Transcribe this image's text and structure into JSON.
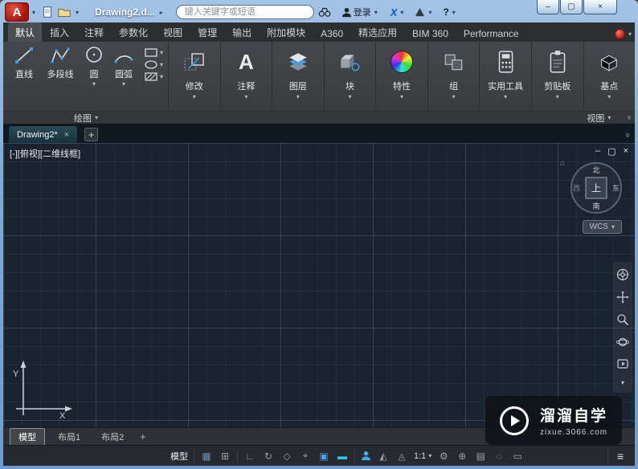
{
  "colors": {
    "titlebar_blue": "#7fa9d6",
    "app_logo_red": "#a51408",
    "ribbon_bg": "#3b3e41",
    "canvas_bg": "#1c2330",
    "grid_line": "#2a3346",
    "accent_blue": "#45a6e8",
    "accent_cyan": "#2ec8de",
    "filetab_bg": "#17323c"
  },
  "titlebar": {
    "title": "Drawing2.d...",
    "search_placeholder": "键入关键字或短语",
    "signin_label": "登录",
    "exchange_label": "X",
    "help_label": "?"
  },
  "glyphs": {
    "chevron_down": "▾",
    "chevron_right": "▸",
    "double_chevron": "»",
    "minimize": "–",
    "maximize": "▢",
    "close": "×",
    "plus": "+",
    "home": "⌂"
  },
  "ribbon": {
    "tabs": [
      "默认",
      "插入",
      "注释",
      "参数化",
      "视图",
      "管理",
      "输出",
      "附加模块",
      "A360",
      "精选应用",
      "BIM 360",
      "Performance"
    ],
    "active_tab": "默认",
    "draw_tools": [
      "直线",
      "多段线",
      "圆",
      "圆弧"
    ],
    "panels": [
      "修改",
      "注释",
      "图层",
      "块",
      "特性",
      "组",
      "实用工具",
      "剪贴板",
      "基点"
    ],
    "draw_panel_title": "绘图",
    "view_panel_title": "视图"
  },
  "filetabs": {
    "active_tab": "Drawing2*"
  },
  "viewport": {
    "label": "[-][俯视][二维线框]",
    "viewcube": {
      "north": "北",
      "south": "南",
      "east": "东",
      "west": "西",
      "top": "上"
    },
    "wcs_label": "WCS"
  },
  "ucs": {
    "x": "X",
    "y": "Y"
  },
  "layout_tabs": {
    "model": "模型",
    "layout1": "布局1",
    "layout2": "布局2"
  },
  "statusbar": {
    "model_label": "模型",
    "scale_label": "1:1",
    "icons": [
      {
        "name": "grid-display-icon",
        "glyph": "▦"
      },
      {
        "name": "snap-mode-icon",
        "glyph": "⊞"
      },
      {
        "name": "ortho-mode-icon",
        "glyph": "∟"
      },
      {
        "name": "polar-tracking-icon",
        "glyph": "↻"
      },
      {
        "name": "isometric-drafting-icon",
        "glyph": "◇"
      },
      {
        "name": "object-snap-tracking-icon",
        "glyph": "⌖"
      },
      {
        "name": "object-snap-icon",
        "glyph": "▣"
      },
      {
        "name": "lineweight-icon",
        "glyph": "▬"
      },
      {
        "name": "annotation-visibility-icon",
        "glyph": "◭"
      },
      {
        "name": "annotation-autoscale-icon",
        "glyph": "◬"
      },
      {
        "name": "workspace-switch-icon",
        "glyph": "⚙"
      },
      {
        "name": "annotation-monitor-icon",
        "glyph": "⊕"
      },
      {
        "name": "quick-properties-icon",
        "glyph": "▤"
      },
      {
        "name": "isolate-objects-icon",
        "glyph": "◌"
      },
      {
        "name": "fullscreen-icon",
        "glyph": "▭"
      },
      {
        "name": "customize-icon",
        "glyph": "≡"
      }
    ]
  },
  "watermark": {
    "title": "溜溜自学",
    "url": "zixue.3066.com"
  }
}
